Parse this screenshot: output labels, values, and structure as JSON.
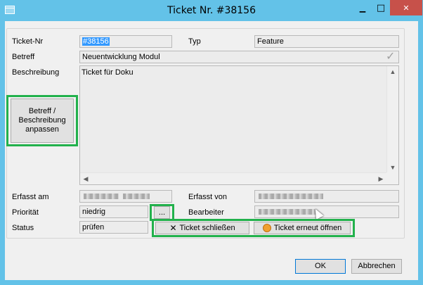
{
  "window": {
    "title": "Ticket Nr. #38156",
    "minimize_glyph": "▁",
    "maximize_glyph": "□",
    "close_glyph": "✕"
  },
  "form": {
    "ticket_nr_label": "Ticket-Nr",
    "ticket_nr_value": "#38156",
    "typ_label": "Typ",
    "typ_value": "Feature",
    "betreff_label": "Betreff",
    "betreff_value": "Neuentwicklung Modul",
    "beschreibung_label": "Beschreibung",
    "beschreibung_value": "Ticket für Doku",
    "edit_button_label": "Betreff /\nBeschreibung\nanpassen",
    "erfasst_am_label": "Erfasst am",
    "erfasst_von_label": "Erfasst von",
    "prioritaet_label": "Priorität",
    "prioritaet_value": "niedrig",
    "ellipsis_button_label": "...",
    "bearbeiter_label": "Bearbeiter",
    "status_label": "Status",
    "status_value": "prüfen",
    "close_ticket_label": "Ticket schließen",
    "reopen_ticket_label": "Ticket erneut öffnen"
  },
  "footer": {
    "ok_label": "OK",
    "cancel_label": "Abbrechen"
  },
  "icons": {
    "check": "✓",
    "close_x": "✕",
    "scroll_up": "▲",
    "scroll_down": "▼",
    "scroll_left": "◀",
    "scroll_right": "▶"
  },
  "colors": {
    "titlebar": "#63c2e8",
    "highlight_border": "#22b14c",
    "close_button": "#c7514a",
    "selection": "#3399ff"
  }
}
